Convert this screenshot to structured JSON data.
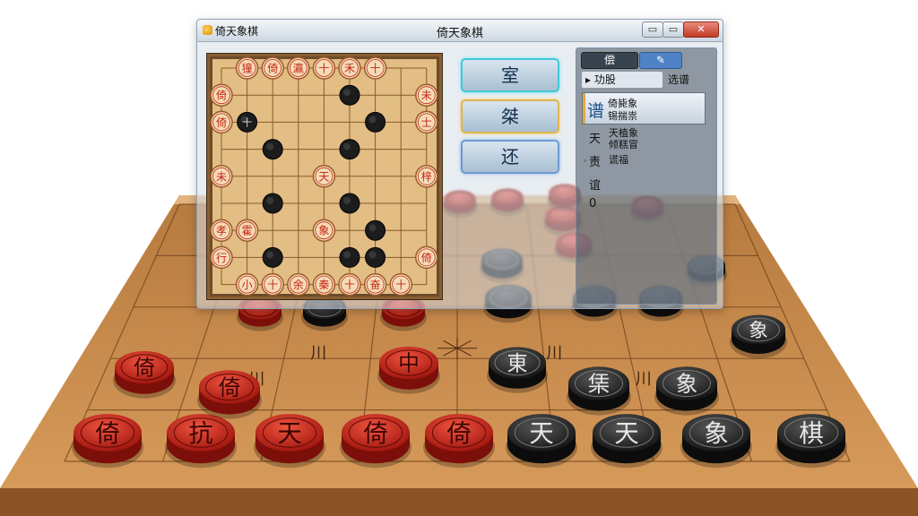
{
  "window": {
    "app_name": "倚天象棋",
    "title": "倚天象棋",
    "buttons": {
      "minimize": "▭",
      "maximize": "▭",
      "close": "✕"
    }
  },
  "actions": [
    {
      "label": "室"
    },
    {
      "label": "桀"
    },
    {
      "label": "还"
    }
  ],
  "panel": {
    "tabs": [
      "偿",
      "✎"
    ],
    "sub_left": "▸ 功股",
    "sub_right": "选谱",
    "selected": {
      "char": "谱",
      "line1": "倚毙象",
      "line2": "锡揣祟"
    },
    "rows": [
      {
        "char": "天",
        "line1": "天植象",
        "line2": "倾糕冒"
      },
      {
        "char": "责",
        "line1": "谎福"
      },
      {
        "char": "谊"
      },
      {
        "char": "0"
      }
    ]
  },
  "mini_board": {
    "pieces": [
      {
        "c": 1,
        "r": 0,
        "side": "red",
        "ch": "獞"
      },
      {
        "c": 2,
        "r": 0,
        "side": "red",
        "ch": "倚"
      },
      {
        "c": 3,
        "r": 0,
        "side": "red",
        "ch": "瀛"
      },
      {
        "c": 4,
        "r": 0,
        "side": "red",
        "ch": "十"
      },
      {
        "c": 5,
        "r": 0,
        "side": "red",
        "ch": "禾"
      },
      {
        "c": 6,
        "r": 0,
        "side": "red",
        "ch": "十"
      },
      {
        "c": 0,
        "r": 1,
        "side": "red",
        "ch": "倚"
      },
      {
        "c": 8,
        "r": 1,
        "side": "red",
        "ch": "未"
      },
      {
        "c": 0,
        "r": 2,
        "side": "red",
        "ch": "倚"
      },
      {
        "c": 8,
        "r": 2,
        "side": "red",
        "ch": "士"
      },
      {
        "c": 0,
        "r": 4,
        "side": "red",
        "ch": "未"
      },
      {
        "c": 4,
        "r": 4,
        "side": "red",
        "ch": "天"
      },
      {
        "c": 8,
        "r": 4,
        "side": "red",
        "ch": "梓"
      },
      {
        "c": 0,
        "r": 6,
        "side": "red",
        "ch": "孝"
      },
      {
        "c": 1,
        "r": 6,
        "side": "red",
        "ch": "霍"
      },
      {
        "c": 4,
        "r": 6,
        "side": "red",
        "ch": "象"
      },
      {
        "c": 0,
        "r": 7,
        "side": "red",
        "ch": "行"
      },
      {
        "c": 8,
        "r": 7,
        "side": "red",
        "ch": "倚"
      },
      {
        "c": 1,
        "r": 8,
        "side": "red",
        "ch": "小"
      },
      {
        "c": 2,
        "r": 8,
        "side": "red",
        "ch": "十"
      },
      {
        "c": 3,
        "r": 8,
        "side": "red",
        "ch": "余"
      },
      {
        "c": 4,
        "r": 8,
        "side": "red",
        "ch": "秦"
      },
      {
        "c": 5,
        "r": 8,
        "side": "red",
        "ch": "十"
      },
      {
        "c": 6,
        "r": 8,
        "side": "red",
        "ch": "奋"
      },
      {
        "c": 7,
        "r": 8,
        "side": "red",
        "ch": "十"
      },
      {
        "c": 5,
        "r": 1,
        "side": "black",
        "ch": ""
      },
      {
        "c": 1,
        "r": 2,
        "side": "black",
        "ch": "十"
      },
      {
        "c": 6,
        "r": 2,
        "side": "black",
        "ch": ""
      },
      {
        "c": 2,
        "r": 3,
        "side": "black",
        "ch": ""
      },
      {
        "c": 5,
        "r": 3,
        "side": "black",
        "ch": ""
      },
      {
        "c": 2,
        "r": 5,
        "side": "black",
        "ch": ""
      },
      {
        "c": 5,
        "r": 5,
        "side": "black",
        "ch": ""
      },
      {
        "c": 6,
        "r": 6,
        "side": "black",
        "ch": ""
      },
      {
        "c": 2,
        "r": 7,
        "side": "black",
        "ch": ""
      },
      {
        "c": 5,
        "r": 7,
        "side": "black",
        "ch": ""
      },
      {
        "c": 6,
        "r": 7,
        "side": "black",
        "ch": ""
      }
    ]
  },
  "board_3d": {
    "red_pieces": [
      {
        "ch": "倚"
      },
      {
        "ch": "抗"
      },
      {
        "ch": "天"
      },
      {
        "ch": "倚"
      },
      {
        "ch": "倚"
      },
      {
        "ch": "倚"
      },
      {
        "ch": "倚"
      },
      {
        "ch": "中"
      }
    ],
    "black_pieces": [
      {
        "ch": "天"
      },
      {
        "ch": "天"
      },
      {
        "ch": "象"
      },
      {
        "ch": "棋"
      },
      {
        "ch": "東"
      },
      {
        "ch": "栠"
      },
      {
        "ch": "象"
      },
      {
        "ch": "象"
      }
    ],
    "board_marks": [
      "川",
      "川",
      "川",
      "川"
    ]
  },
  "colors": {
    "red_piece": "#c8251c",
    "black_piece": "#222222",
    "wood": "#c98a49"
  }
}
